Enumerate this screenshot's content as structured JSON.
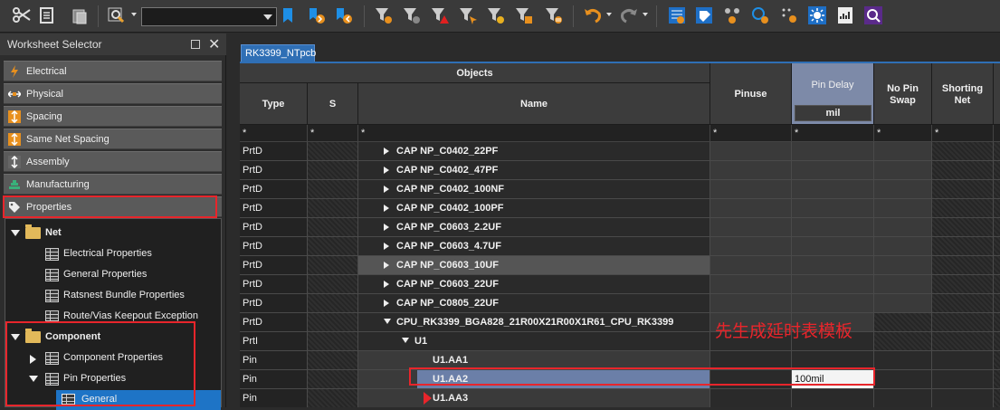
{
  "toolbar": {
    "combo_value": ""
  },
  "left_pane": {
    "title": "Worksheet Selector",
    "close_glyph": "✕",
    "selectors": [
      {
        "label": "Electrical",
        "icon": "lightning-icon"
      },
      {
        "label": "Physical",
        "icon": "arrows-icon"
      },
      {
        "label": "Spacing",
        "icon": "spacing-icon"
      },
      {
        "label": "Same Net Spacing",
        "icon": "same-net-spacing-icon"
      },
      {
        "label": "Assembly",
        "icon": "assembly-icon"
      },
      {
        "label": "Manufacturing",
        "icon": "manufacturing-icon"
      },
      {
        "label": "Properties",
        "icon": "tag-icon"
      }
    ],
    "tree": {
      "net": "Net",
      "net_items": [
        "Electrical Properties",
        "General Properties",
        "Ratsnest Bundle Properties",
        "Route/Vias Keepout Exception"
      ],
      "component": "Component",
      "component_props": "Component Properties",
      "pin_props": "Pin Properties",
      "general": "General"
    }
  },
  "tab": {
    "label": "RK3399_NTpcb"
  },
  "grid": {
    "headers": {
      "objects": "Objects",
      "type": "Type",
      "s": "S",
      "name": "Name",
      "pinuse": "Pinuse",
      "pin_delay": "Pin Delay",
      "pin_delay_unit": "mil",
      "no_pin_swap_1": "No Pin",
      "no_pin_swap_2": "Swap",
      "shorting_net_1": "Shorting",
      "shorting_net_2": "Net"
    },
    "filter": "*",
    "rows": [
      {
        "type": "PrtD",
        "name": "CAP NP_C0402_22PF",
        "level": 0,
        "expand": "right"
      },
      {
        "type": "PrtD",
        "name": "CAP NP_C0402_47PF",
        "level": 0,
        "expand": "right"
      },
      {
        "type": "PrtD",
        "name": "CAP NP_C0402_100NF",
        "level": 0,
        "expand": "right"
      },
      {
        "type": "PrtD",
        "name": "CAP NP_C0402_100PF",
        "level": 0,
        "expand": "right"
      },
      {
        "type": "PrtD",
        "name": "CAP NP_C0603_2.2UF",
        "level": 0,
        "expand": "right"
      },
      {
        "type": "PrtD",
        "name": "CAP NP_C0603_4.7UF",
        "level": 0,
        "expand": "right"
      },
      {
        "type": "PrtD",
        "name": "CAP NP_C0603_10UF",
        "level": 0,
        "expand": "right"
      },
      {
        "type": "PrtD",
        "name": "CAP NP_C0603_22UF",
        "level": 0,
        "expand": "right"
      },
      {
        "type": "PrtD",
        "name": "CAP NP_C0805_22UF",
        "level": 0,
        "expand": "right"
      },
      {
        "type": "PrtD",
        "name": "CPU_RK3399_BGA828_21R00X21R00X1R61_CPU_RK3399",
        "level": 0,
        "expand": "down"
      },
      {
        "type": "PrtI",
        "name": "U1",
        "level": 1,
        "expand": "down"
      },
      {
        "type": "Pin",
        "name": "U1.AA1",
        "level": 2,
        "expand": ""
      },
      {
        "type": "Pin",
        "name": "U1.AA2",
        "level": 2,
        "expand": "",
        "pin_delay": "100mil"
      },
      {
        "type": "Pin",
        "name": "U1.AA3",
        "level": 2,
        "expand": ""
      }
    ]
  },
  "annotation": {
    "text": "先生成延时表模板"
  },
  "colors": {
    "accent": "#1e74c6",
    "highlight": "#e8252b",
    "tab": "#2f6fb5"
  }
}
